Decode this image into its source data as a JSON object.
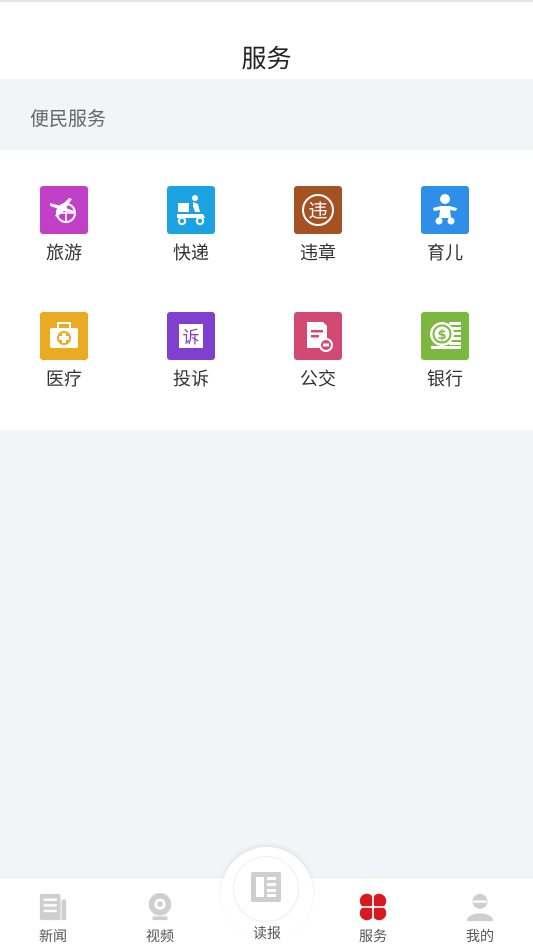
{
  "header": {
    "title": "服务"
  },
  "section": {
    "title": "便民服务"
  },
  "services": [
    {
      "label": "旅游",
      "icon": "airplane-globe-icon",
      "color": "#c23fc8"
    },
    {
      "label": "快递",
      "icon": "delivery-scooter-icon",
      "color": "#1aa3e0"
    },
    {
      "label": "违章",
      "icon": "violation-stamp-icon",
      "color": "#a45124"
    },
    {
      "label": "育儿",
      "icon": "baby-icon",
      "color": "#2f8fe8"
    },
    {
      "label": "医疗",
      "icon": "medical-kit-icon",
      "color": "#e9ac21"
    },
    {
      "label": "投诉",
      "icon": "complaint-icon",
      "color": "#7f3fcf"
    },
    {
      "label": "公交",
      "icon": "bus-card-icon",
      "color": "#d24a73"
    },
    {
      "label": "银行",
      "icon": "bank-coins-icon",
      "color": "#7cb83f"
    }
  ],
  "tabbar": {
    "news": "新闻",
    "video": "视频",
    "paper": "读报",
    "service": "服务",
    "mine": "我的"
  },
  "colors": {
    "active": "#d9191f",
    "inactive": "#c8c8c8"
  }
}
